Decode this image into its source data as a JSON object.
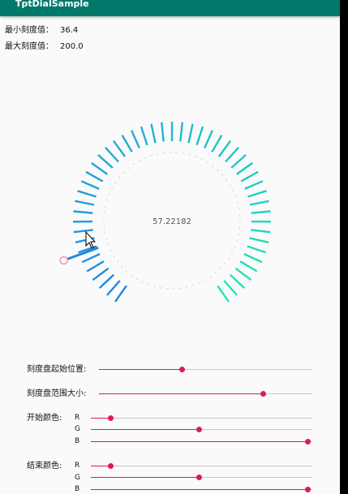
{
  "app": {
    "title": "TptDialSample"
  },
  "info": {
    "min_label": "最小刻度值：",
    "min_value": "36.4",
    "max_label": "最大刻度值：",
    "max_value": "200.0"
  },
  "dial": {
    "center_value": "57.22182",
    "start_color": "#1e88e5",
    "end_color": "#1de9b6",
    "pointer_color": "#1e88e5",
    "knob_color": "#f48fb1",
    "tick_count": 49,
    "pointer_fraction": 0.12
  },
  "controls": {
    "start_position": {
      "label": "刻度盘起始位置:",
      "fraction": 0.39
    },
    "range_size": {
      "label": "刻度盘范围大小:",
      "fraction": 0.77
    },
    "start_color": {
      "label": "开始颜色:",
      "channels": [
        {
          "name": "R",
          "fraction": 0.09
        },
        {
          "name": "G",
          "fraction": 0.49
        },
        {
          "name": "B",
          "fraction": 0.98
        }
      ]
    },
    "end_color": {
      "label": "结束颜色:",
      "channels": [
        {
          "name": "R",
          "fraction": 0.09
        },
        {
          "name": "G",
          "fraction": 0.49
        },
        {
          "name": "B",
          "fraction": 0.98
        }
      ]
    }
  }
}
